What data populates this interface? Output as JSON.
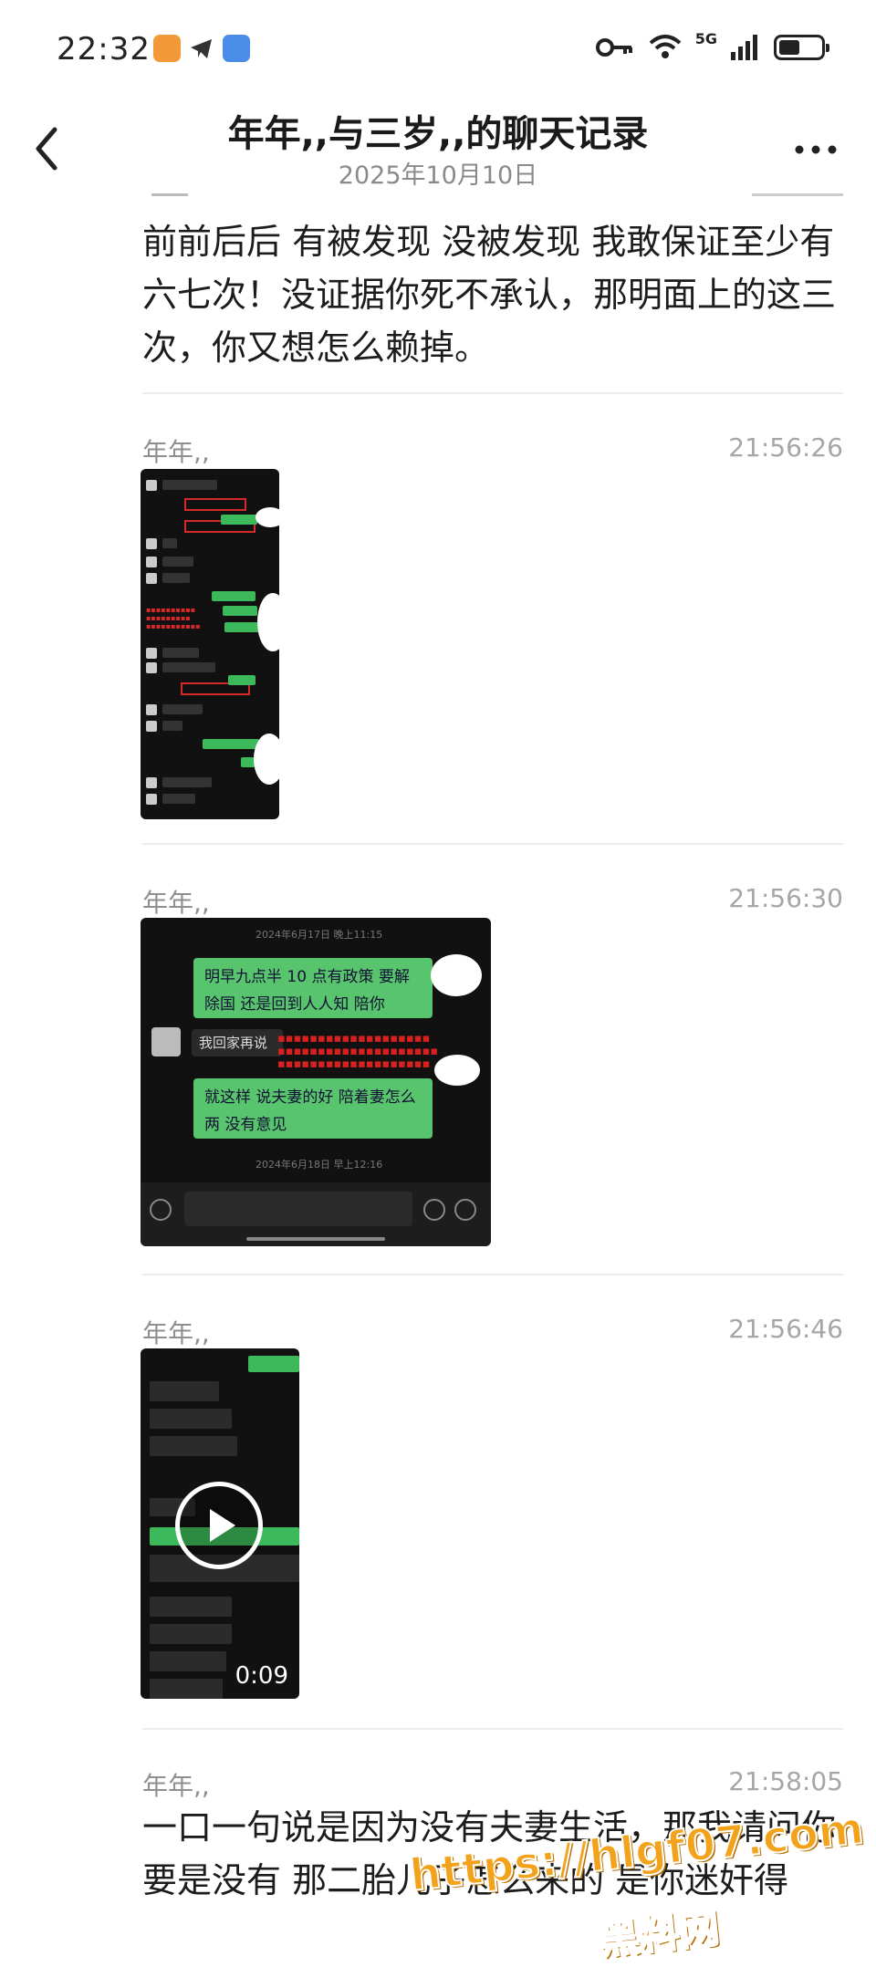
{
  "status_bar": {
    "time": "22:32",
    "network": "5G",
    "battery_level": 0.5
  },
  "header": {
    "title": "年年,,与三岁,,的聊天记录",
    "date": "2025年10月10日"
  },
  "messages": [
    {
      "type": "text",
      "text": "前前后后 有被发现 没被发现 我敢保证至少有六七次！没证据你死不承认，那明面上的这三次，你又想怎么赖掉。"
    },
    {
      "type": "image",
      "sender": "年年,,",
      "time": "21:56:26"
    },
    {
      "type": "image",
      "sender": "年年,,",
      "time": "21:56:30",
      "inner": {
        "stamp_top": "2024年6月17日 晚上11:15",
        "bubble1": "明早九点半 10 点有政策  要解除国 还是回到人人知 陪你",
        "reply": "我回家再说",
        "bubble2": "就这样 说夫妻的好 陪着妻怎么两 没有意见",
        "stamp_bottom": "2024年6月18日 早上12:16"
      }
    },
    {
      "type": "video",
      "sender": "年年,,",
      "time": "21:56:46",
      "duration": "0:09"
    },
    {
      "type": "text",
      "sender": "年年,,",
      "time": "21:58:05",
      "lines": [
        "一口一句说是因为没有夫妻生活，那我请问你",
        "要是没有 那二胎儿子怎么来的 是你迷奸得"
      ]
    }
  ],
  "watermark": {
    "url": "https://hlgf07.com",
    "name": "黑料网"
  }
}
